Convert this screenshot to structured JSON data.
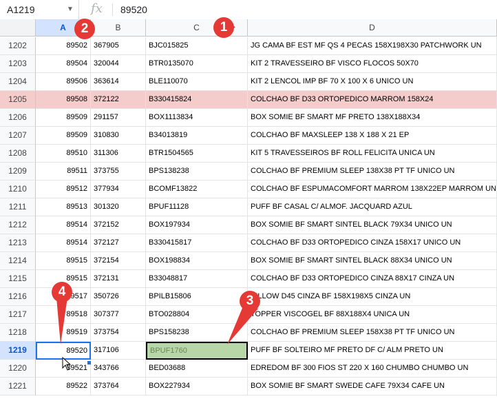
{
  "formula_bar": {
    "name_box": "A1219",
    "fx_label": "fx",
    "value": "89520"
  },
  "columns": [
    "A",
    "B",
    "C",
    "D"
  ],
  "rows": [
    {
      "n": "1202",
      "a": "89502",
      "b": "367905",
      "c": "BJC015825",
      "d": "JG CAMA BF EST MF QS 4 PECAS 158X198X30 PATCHWORK UN"
    },
    {
      "n": "1203",
      "a": "89504",
      "b": "320044",
      "c": "BTR0135070",
      "d": "KIT 2 TRAVESSEIRO BF VISCO FLOCOS 50X70"
    },
    {
      "n": "1204",
      "a": "89506",
      "b": "363614",
      "c": "BLE110070",
      "d": "KIT 2 LENCOL IMP BF 70 X 100 X 6 UNICO UN"
    },
    {
      "n": "1205",
      "a": "89508",
      "b": "372122",
      "c": "B330415824",
      "d": "COLCHAO BF D33 ORTOPEDICO MARROM 158X24",
      "highlight": true
    },
    {
      "n": "1206",
      "a": "89509",
      "b": "291157",
      "c": "BOX1113834",
      "d": "BOX SOMIE BF SMART MF PRETO 138X188X34"
    },
    {
      "n": "1207",
      "a": "89509",
      "b": "310830",
      "c": "B34013819",
      "d": "COLCHAO BF MAXSLEEP 138 X 188 X 21 EP"
    },
    {
      "n": "1208",
      "a": "89510",
      "b": "311306",
      "c": "BTR1504565",
      "d": "KIT 5 TRAVESSEIROS BF ROLL FELICITA UNICA UN"
    },
    {
      "n": "1209",
      "a": "89511",
      "b": "373755",
      "c": "BPS138238",
      "d": "COLCHAO BF PREMIUM SLEEP 138X38 PT TF UNICO UN"
    },
    {
      "n": "1210",
      "a": "89512",
      "b": "377934",
      "c": "BCOMF13822",
      "d": "COLCHAO BF ESPUMACOMFORT MARROM 138X22EP MARROM UN"
    },
    {
      "n": "1211",
      "a": "89513",
      "b": "301320",
      "c": "BPUF11128",
      "d": "PUFF BF CASAL C/ ALMOF. JACQUARD AZUL"
    },
    {
      "n": "1212",
      "a": "89514",
      "b": "372152",
      "c": "BOX197934",
      "d": "BOX SOMIE BF SMART SINTEL BLACK 79X34 UNICO UN"
    },
    {
      "n": "1213",
      "a": "89514",
      "b": "372127",
      "c": "B330415817",
      "d": "COLCHAO BF D33 ORTOPEDICO CINZA 158X17 UNICO UN"
    },
    {
      "n": "1214",
      "a": "89515",
      "b": "372154",
      "c": "BOX198834",
      "d": "BOX SOMIE BF SMART SINTEL BLACK 88X34 UNICO UN"
    },
    {
      "n": "1215",
      "a": "89515",
      "b": "372131",
      "c": "B33048817",
      "d": "COLCHAO BF D33 ORTOPEDICO CINZA 88X17 CINZA UN"
    },
    {
      "n": "1216",
      "a": "89517",
      "b": "350726",
      "c": "BPILB15806",
      "d": "PILLOW D45 CINZA BF 158X198X5 CINZA UN"
    },
    {
      "n": "1217",
      "a": "89518",
      "b": "307377",
      "c": "BTO028804",
      "d": "TOPPER VISCOGEL BF 88X188X4 UNICA UN"
    },
    {
      "n": "1218",
      "a": "89519",
      "b": "373754",
      "c": "BPS158238",
      "d": "COLCHAO BF PREMIUM SLEEP 158X38 PT TF UNICO UN"
    },
    {
      "n": "1219",
      "a": "89520",
      "b": "317106",
      "c": "BPUF1760",
      "d": "PUFF BF SOLTEIRO MF PRETO DF C/ ALM PRETO UN",
      "active": true
    },
    {
      "n": "1220",
      "a": "89521",
      "b": "343766",
      "c": "BED03688",
      "d": "EDREDOM BF 300 FIOS ST 220 X 160 CHUMBO CHUMBO UN"
    },
    {
      "n": "1221",
      "a": "89522",
      "b": "373764",
      "c": "BOX227934",
      "d": "BOX SOMIE BF SMART SWEDE CAFE 79X34 CAFE UN"
    }
  ],
  "markers": [
    "1",
    "2",
    "3",
    "4"
  ],
  "colors": {
    "marker": "#e53935",
    "active_border": "#1a73e8",
    "highlight_row": "#f4cccc",
    "green_cell": "#b7d7a8"
  }
}
